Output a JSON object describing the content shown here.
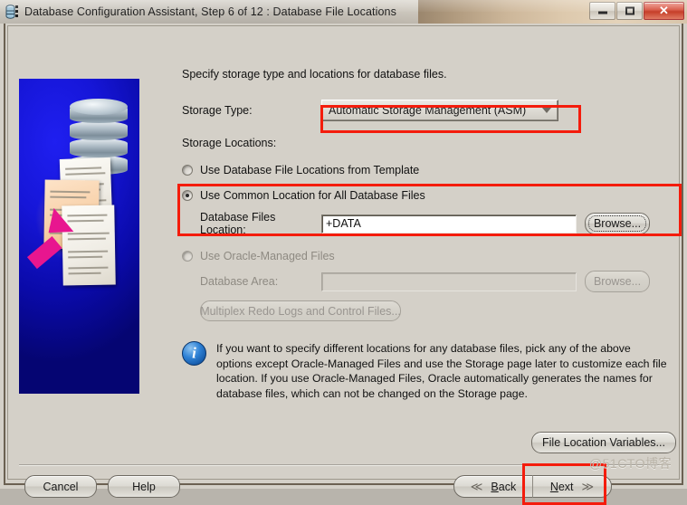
{
  "window": {
    "title": "Database Configuration Assistant, Step 6 of 12 : Database File Locations",
    "icon": "database-icon",
    "controls": {
      "minimize": "minimize-icon",
      "maximize": "maximize-icon",
      "close": "✕"
    }
  },
  "content": {
    "headline": "Specify storage type and locations for database files.",
    "storage_type_label": "Storage Type:",
    "storage_type_value": "Automatic Storage Management (ASM)",
    "storage_locations_label": "Storage Locations:",
    "option_template": "Use Database File Locations from Template",
    "option_common": "Use Common Location for All Database Files",
    "files_location_label": "Database Files Location:",
    "files_location_value": "+DATA",
    "browse_label": "Browse...",
    "option_oracle_managed": "Use Oracle-Managed Files",
    "database_area_label": "Database Area:",
    "database_area_value": "",
    "browse_label_2": "Browse...",
    "multiplex_label": "Multiplex Redo Logs and Control Files...",
    "info_text": "If you want to specify different locations for any database files, pick any of the above options except Oracle-Managed Files and use the Storage page later to customize each file location. If you use Oracle-Managed Files, Oracle automatically generates the names for database files, which can not be changed on the Storage page."
  },
  "buttons": {
    "file_location_variables": "File Location Variables...",
    "cancel": "Cancel",
    "help": "Help",
    "back": "Back",
    "back_mnemonic": "B",
    "back_rest": "ack",
    "next": "Next",
    "next_mnemonic": "N",
    "next_rest": "ext",
    "back_chevron": "≪",
    "next_chevron": "≫"
  },
  "annotations": {
    "color": "#f41c0c",
    "targets": [
      "storage-type-combo",
      "common-location-group",
      "next-button"
    ]
  },
  "watermark": "@51CTO博客",
  "colors": {
    "dialog_bg": "#d4d0c8",
    "art_blue": "#1616d8",
    "arrow_magenta": "#e8168f",
    "info_blue": "#2f82d6",
    "annotation_red": "#f41c0c"
  }
}
